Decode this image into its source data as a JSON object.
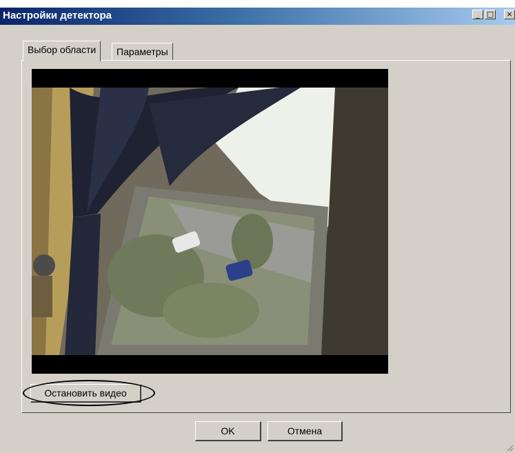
{
  "window": {
    "title": "Настройки детектора",
    "controls": {
      "minimize": "_",
      "maximize": "□",
      "close": "×"
    }
  },
  "tabs": [
    {
      "label": "Выбор области",
      "active": true
    },
    {
      "label": "Параметры",
      "active": false
    }
  ],
  "video": {
    "stop_label": "Остановить видео"
  },
  "dialog": {
    "ok_label": "OK",
    "cancel_label": "Отмена"
  },
  "colors": {
    "title_start": "#0a246a",
    "title_end": "#a6caf0",
    "face": "#d4d0c8",
    "annotation": "#000000"
  }
}
